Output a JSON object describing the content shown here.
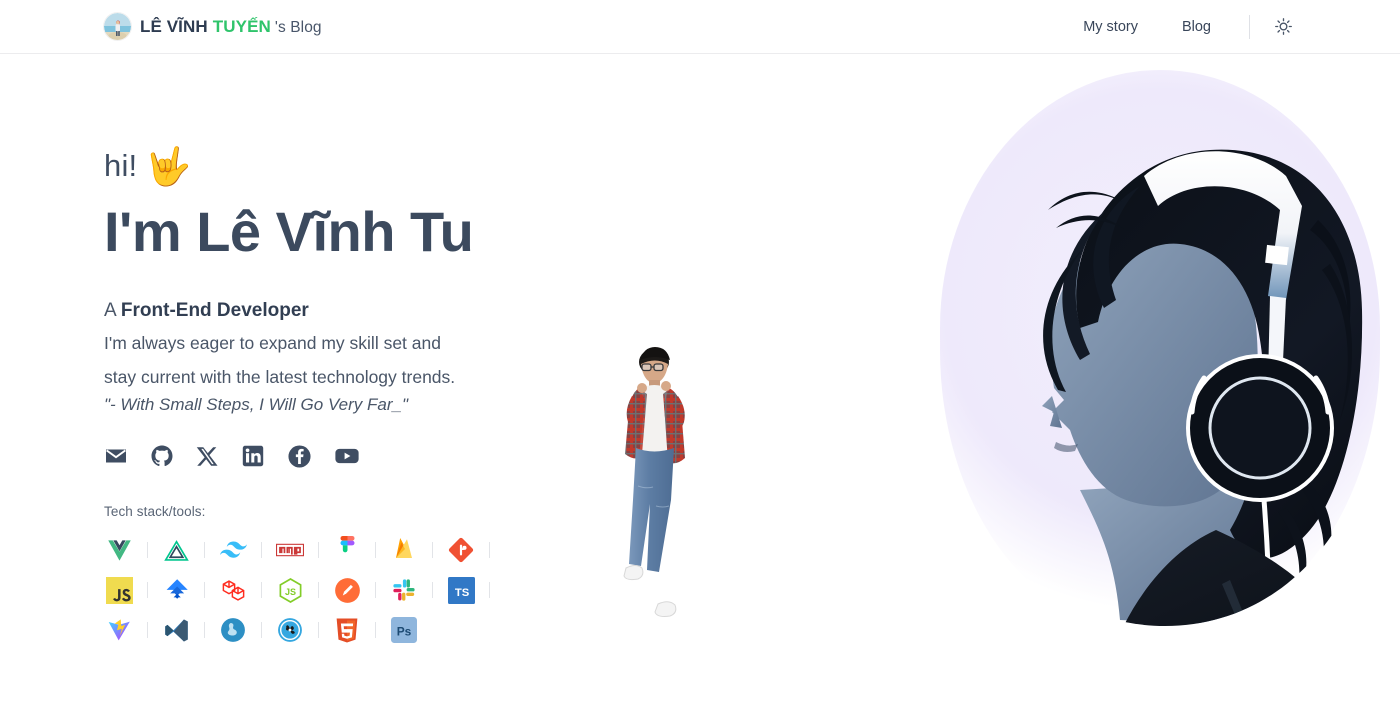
{
  "header": {
    "brand": {
      "avatar_icon": "profile-photo-avatar",
      "name_dark": "LÊ VĨNH",
      "name_green": "TUYẾN",
      "suffix": "'s Blog",
      "green_color": "#2fc46b",
      "dark_color": "#2e3c51"
    },
    "nav": [
      {
        "label": "My story",
        "name": "nav-my-story"
      },
      {
        "label": "Blog",
        "name": "nav-blog"
      }
    ],
    "theme_toggle": {
      "icon": "sun-icon",
      "label": "Light mode"
    }
  },
  "hero": {
    "greeting": "hi!",
    "greeting_emoji": "🤟",
    "title": "I'm Lê Vĩnh Tu",
    "role_prefix": "A ",
    "role": "Front-End Developer",
    "description_line1": "I'm always eager to expand my skill set and",
    "description_line2": "stay current with the latest technology trends.",
    "quote": "\"- With Small Steps, I Will Go Very Far_\"",
    "title_color": "#3c4a5e",
    "art_alt": "anime-profile-with-headphones-illustration",
    "avatar3d_alt": "3d-character-plaid-shirt"
  },
  "socials": [
    {
      "name": "social-email",
      "icon": "email-icon",
      "label": "Email"
    },
    {
      "name": "social-github",
      "icon": "github-icon",
      "label": "GitHub"
    },
    {
      "name": "social-x",
      "icon": "x-twitter-icon",
      "label": "X"
    },
    {
      "name": "social-linkedin",
      "icon": "linkedin-icon",
      "label": "LinkedIn"
    },
    {
      "name": "social-facebook",
      "icon": "facebook-icon",
      "label": "Facebook"
    },
    {
      "name": "social-youtube",
      "icon": "youtube-icon",
      "label": "YouTube"
    }
  ],
  "tech_stack": {
    "label": "Tech stack/tools:",
    "rows": [
      [
        {
          "name": "tool-vue",
          "icon": "vue-icon",
          "label": "Vue.js"
        },
        {
          "name": "tool-nuxt",
          "icon": "nuxt-icon",
          "label": "Nuxt"
        },
        {
          "name": "tool-tailwind",
          "icon": "tailwind-icon",
          "label": "Tailwind CSS"
        },
        {
          "name": "tool-npm",
          "icon": "npm-icon",
          "label": "npm"
        },
        {
          "name": "tool-figma",
          "icon": "figma-icon",
          "label": "Figma"
        },
        {
          "name": "tool-firebase",
          "icon": "firebase-icon",
          "label": "Firebase"
        },
        {
          "name": "tool-git",
          "icon": "git-icon",
          "label": "Git"
        }
      ],
      [
        {
          "name": "tool-javascript",
          "icon": "javascript-icon",
          "label": "JavaScript"
        },
        {
          "name": "tool-jira",
          "icon": "jira-icon",
          "label": "Jira"
        },
        {
          "name": "tool-laravel",
          "icon": "laravel-icon",
          "label": "Laravel"
        },
        {
          "name": "tool-nodejs",
          "icon": "nodejs-icon",
          "label": "Node.js"
        },
        {
          "name": "tool-postman",
          "icon": "postman-icon",
          "label": "Postman"
        },
        {
          "name": "tool-slack",
          "icon": "slack-icon",
          "label": "Slack"
        },
        {
          "name": "tool-typescript",
          "icon": "typescript-icon",
          "label": "TypeScript"
        }
      ],
      [
        {
          "name": "tool-vite",
          "icon": "vite-icon",
          "label": "Vite"
        },
        {
          "name": "tool-vscode",
          "icon": "vscode-icon",
          "label": "VS Code"
        },
        {
          "name": "tool-sqlserver",
          "icon": "sql-server-icon",
          "label": "SQL Server"
        },
        {
          "name": "tool-jenkins",
          "icon": "jenkins-icon",
          "label": "Jenkins"
        },
        {
          "name": "tool-html5",
          "icon": "html5-icon",
          "label": "HTML5"
        },
        {
          "name": "tool-photoshop",
          "icon": "photoshop-icon",
          "label": "Photoshop"
        }
      ]
    ]
  }
}
